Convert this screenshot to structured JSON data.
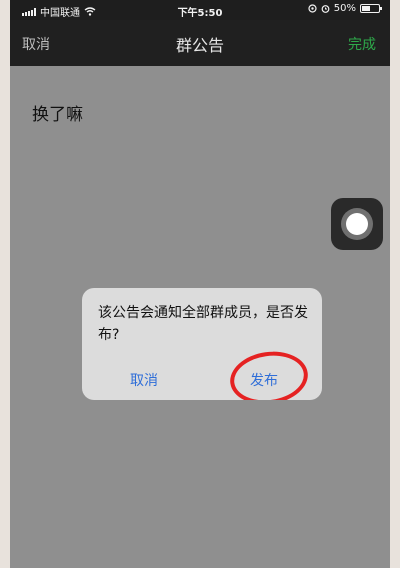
{
  "status_bar": {
    "carrier": "中国联通",
    "time": "下午5:50",
    "battery_percent": "50%",
    "battery_level": 0.5,
    "icons": [
      "signal-icon",
      "wifi-icon",
      "location-icon",
      "alarm-icon",
      "battery-icon"
    ]
  },
  "nav": {
    "cancel_label": "取消",
    "title": "群公告",
    "done_label": "完成"
  },
  "content": {
    "announcement_text": "换了嘛"
  },
  "dialog": {
    "message": "该公告会通知全部群成员，是否发布?",
    "cancel_label": "取消",
    "publish_label": "发布"
  },
  "colors": {
    "done": "#2ea84a",
    "dialog_button": "#2f6ed8",
    "annotation": "#e52222"
  }
}
